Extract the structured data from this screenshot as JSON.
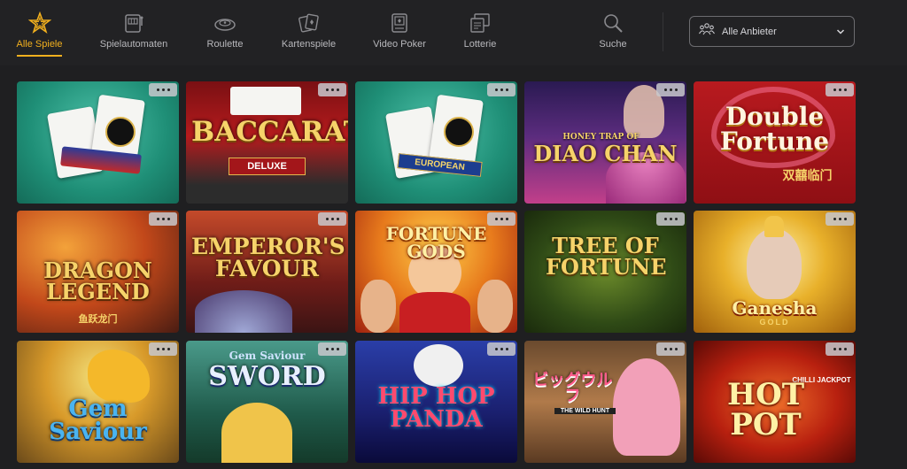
{
  "nav": {
    "items": [
      {
        "label": "Alle Spiele",
        "active": true,
        "icon": "star-icon"
      },
      {
        "label": "Spielautomaten",
        "icon": "slot-machine-icon"
      },
      {
        "label": "Roulette",
        "icon": "roulette-icon"
      },
      {
        "label": "Kartenspiele",
        "icon": "cards-icon"
      },
      {
        "label": "Video Poker",
        "icon": "video-poker-icon"
      },
      {
        "label": "Lotterie",
        "icon": "lottery-icon"
      },
      {
        "label": "Suche",
        "icon": "search-icon"
      }
    ],
    "provider_select": {
      "label": "Alle Anbieter",
      "icon": "providers-icon"
    }
  },
  "games": [
    {
      "title": "",
      "subtitle": "",
      "theme": "blackjack-usa"
    },
    {
      "title": "BACCARAT",
      "subtitle": "DELUXE",
      "theme": "baccarat"
    },
    {
      "title": "",
      "subtitle": "EUROPEAN",
      "theme": "blackjack-eu"
    },
    {
      "title": "DIAO CHAN",
      "subtitle": "HONEY TRAP OF",
      "theme": "diao-chan"
    },
    {
      "title": "Double Fortune",
      "subtitle": "双囍临门",
      "theme": "double-fortune"
    },
    {
      "title": "DRAGON LEGEND",
      "subtitle": "鱼跃龙门",
      "theme": "dragon-legend"
    },
    {
      "title": "EMPEROR'S FAVOUR",
      "subtitle": "",
      "theme": "emperor"
    },
    {
      "title": "FORTUNE GODS",
      "subtitle": "",
      "theme": "fortune-gods"
    },
    {
      "title": "TREE OF FORTUNE",
      "subtitle": "",
      "theme": "tree"
    },
    {
      "title": "Ganesha",
      "subtitle": "GOLD",
      "theme": "ganesha"
    },
    {
      "title": "Gem Saviour",
      "subtitle": "",
      "theme": "gem-saviour"
    },
    {
      "title": "SWORD",
      "subtitle": "Gem Saviour",
      "theme": "sword"
    },
    {
      "title": "HIP HOP PANDA",
      "subtitle": "",
      "theme": "panda"
    },
    {
      "title": "ビッグウルフ",
      "subtitle": "THE WILD HUNT",
      "theme": "wolf"
    },
    {
      "title": "HOT POT",
      "subtitle": "CHILLI JACKPOT",
      "theme": "hotpot"
    }
  ],
  "colors": {
    "accent": "#f2b01e",
    "background": "#1f1f21"
  }
}
